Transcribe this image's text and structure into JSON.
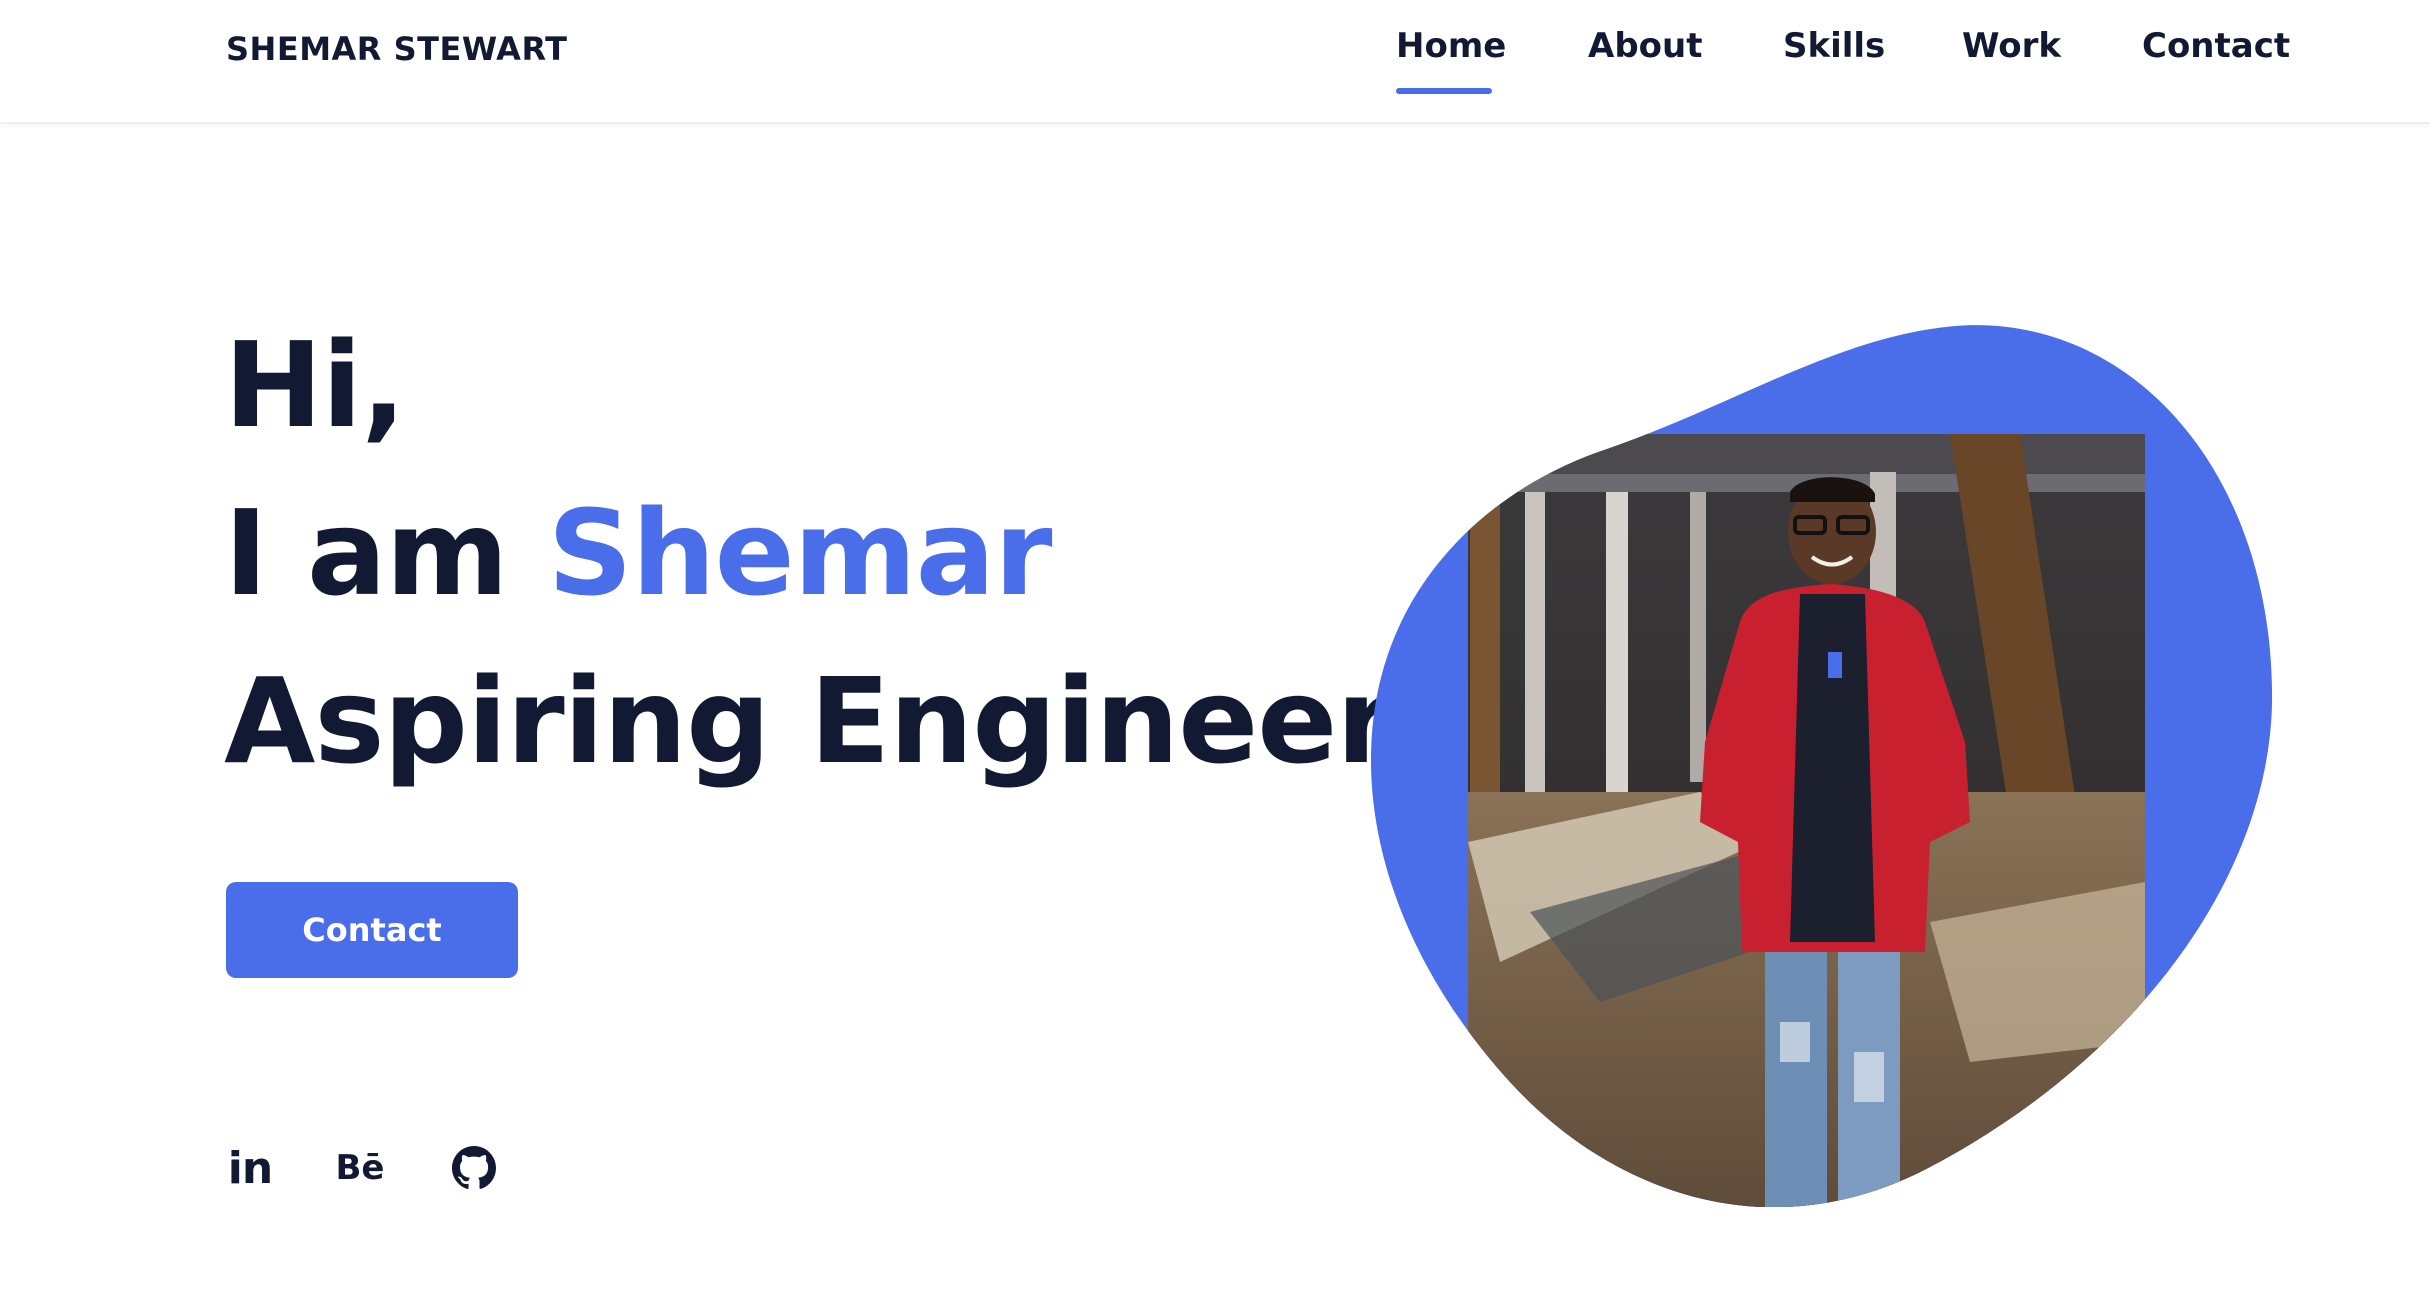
{
  "header": {
    "logo": "SHEMAR STEWART",
    "nav": [
      {
        "label": "Home",
        "active": true
      },
      {
        "label": "About",
        "active": false
      },
      {
        "label": "Skills",
        "active": false
      },
      {
        "label": "Work",
        "active": false
      },
      {
        "label": "Contact",
        "active": false
      }
    ]
  },
  "hero": {
    "greeting": "Hi,",
    "intro_prefix": "I am ",
    "name": "Shemar",
    "title": "Aspiring Engineer",
    "cta_label": "Contact"
  },
  "social": [
    {
      "icon": "linkedin-icon",
      "text": "in"
    },
    {
      "icon": "behance-icon",
      "text": "Bē"
    },
    {
      "icon": "github-icon"
    }
  ],
  "colors": {
    "accent": "#4a6dea",
    "text": "#121a33",
    "background": "#ffffff"
  }
}
